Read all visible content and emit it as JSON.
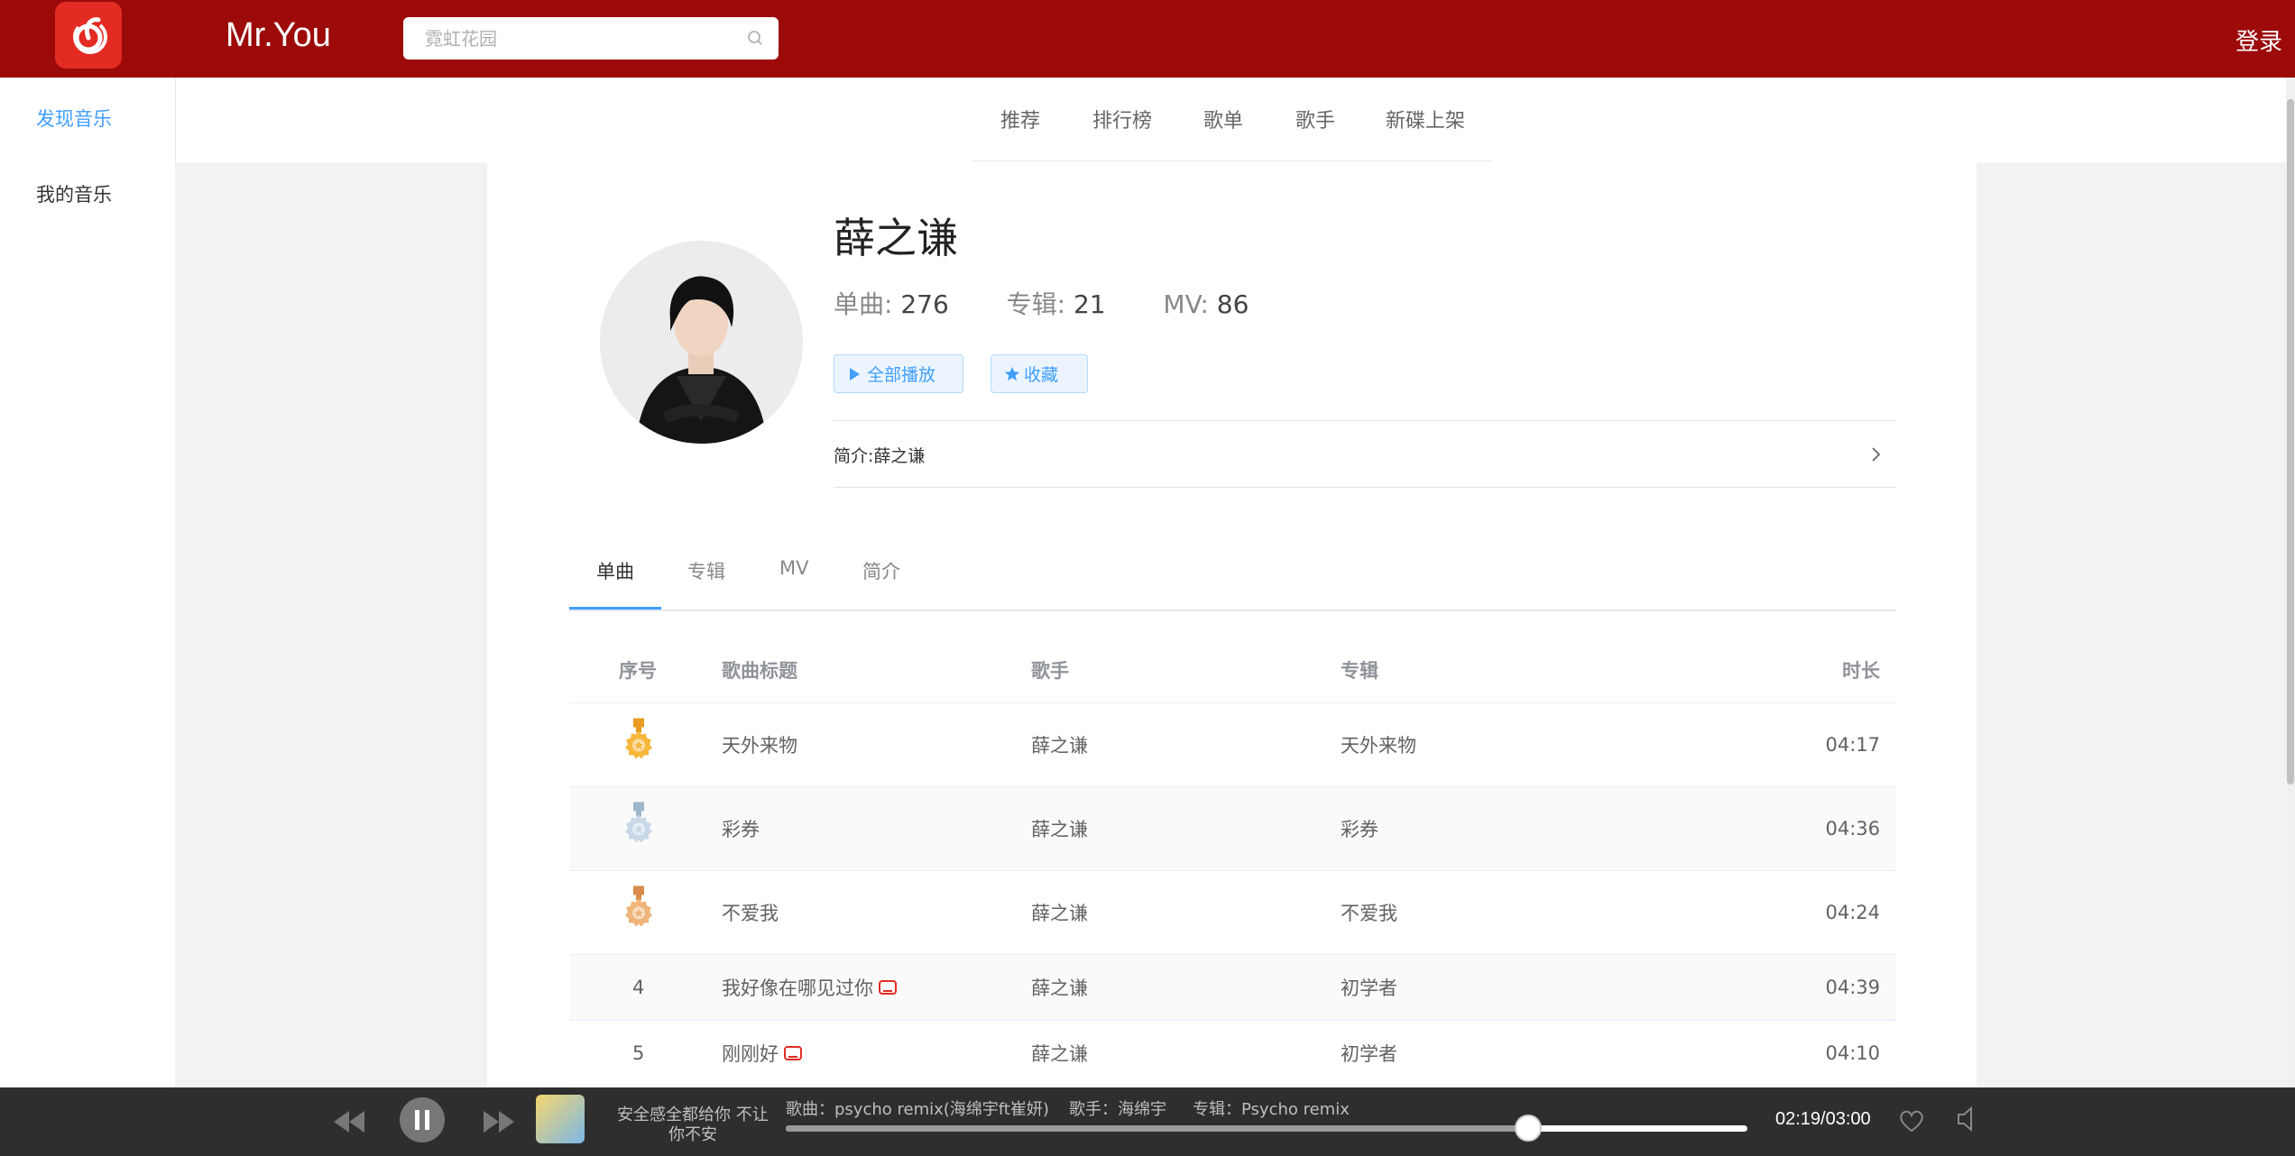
{
  "header": {
    "brand": "Mr.You",
    "search_placeholder": "霓虹花园",
    "login": "登录",
    "colors": {
      "bar": "#9c0a0a",
      "logo": "#e32b23"
    }
  },
  "sidebar": {
    "items": [
      {
        "label": "发现音乐",
        "active": true
      },
      {
        "label": "我的音乐",
        "active": false
      }
    ]
  },
  "top_nav": {
    "items": [
      "推荐",
      "排行榜",
      "歌单",
      "歌手",
      "新碟上架"
    ]
  },
  "artist": {
    "name": "薛之谦",
    "singles_label": "单曲:",
    "singles": "276",
    "albums_label": "专辑:",
    "albums": "21",
    "mv_label": "MV:",
    "mvs": "86",
    "play_all": "全部播放",
    "collect": "收藏",
    "intro_label": "简介:",
    "intro": "薛之谦"
  },
  "tabs": [
    "单曲",
    "专辑",
    "MV",
    "简介"
  ],
  "table": {
    "headers": {
      "index": "序号",
      "title": "歌曲标题",
      "artist": "歌手",
      "album": "专辑",
      "duration": "时长"
    },
    "rows": [
      {
        "rank": "1",
        "medal": "gold",
        "title": "天外来物",
        "mv": false,
        "artist": "薛之谦",
        "album": "天外来物",
        "duration": "04:17"
      },
      {
        "rank": "2",
        "medal": "silver",
        "title": "彩券",
        "mv": false,
        "artist": "薛之谦",
        "album": "彩券",
        "duration": "04:36"
      },
      {
        "rank": "3",
        "medal": "bronze",
        "title": "不爱我",
        "mv": false,
        "artist": "薛之谦",
        "album": "不爱我",
        "duration": "04:24"
      },
      {
        "rank": "4",
        "medal": "",
        "title": "我好像在哪见过你",
        "mv": true,
        "artist": "薛之谦",
        "album": "初学者",
        "duration": "04:39"
      },
      {
        "rank": "5",
        "medal": "",
        "title": "刚刚好",
        "mv": true,
        "artist": "薛之谦",
        "album": "初学者",
        "duration": "04:10"
      }
    ]
  },
  "player": {
    "now_playing_line1": "安全感全都给你 不让",
    "now_playing_line2": "你不安",
    "song": "歌曲：psycho remix(海绵宇ft崔妍)",
    "singer": "歌手：海绵宇",
    "album": "专辑：Psycho remix",
    "time": "02:19/03:00",
    "progress": 0.772
  }
}
